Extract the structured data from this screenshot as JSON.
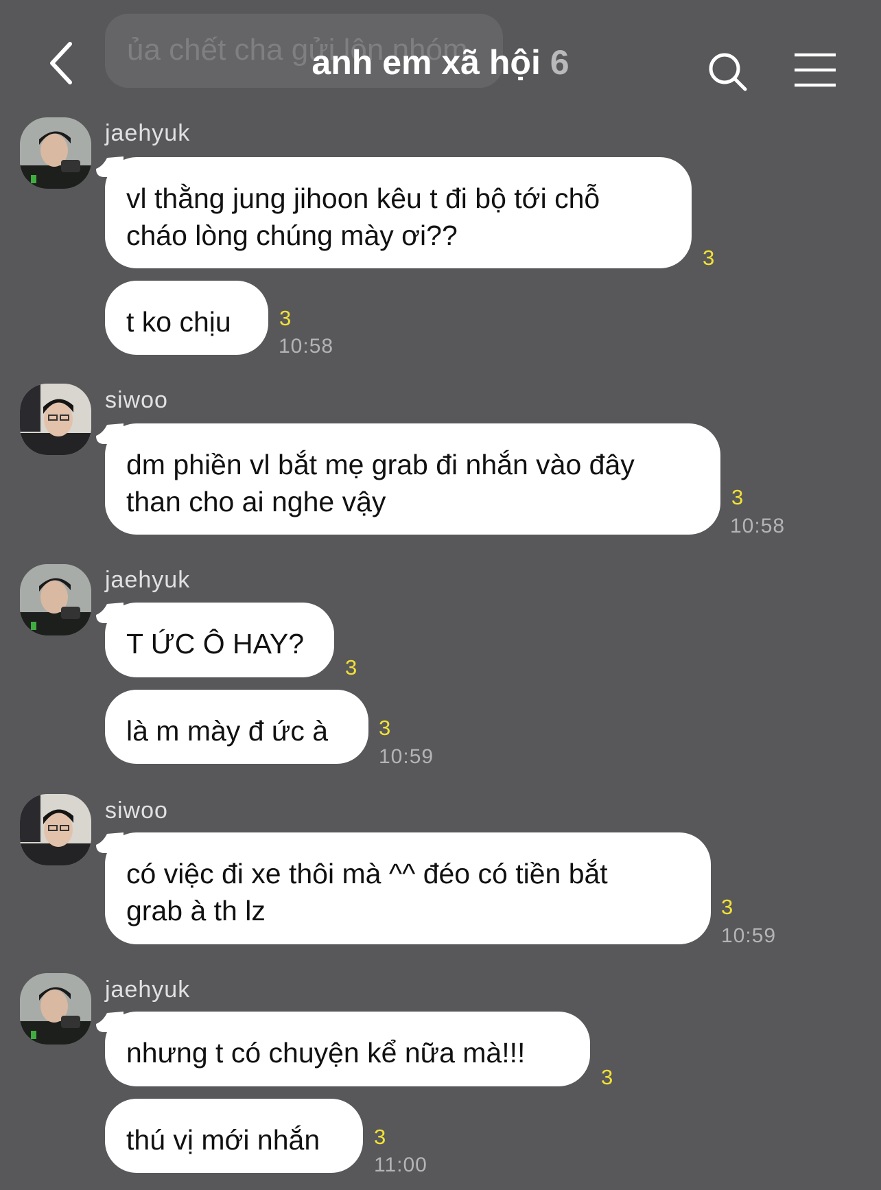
{
  "header": {
    "title": "anh em xã hội",
    "member_count": "6",
    "prev_message_preview": "ủa chết cha gửi lộn nhóm",
    "back_icon": "chevron-left-icon",
    "search_icon": "search-icon",
    "menu_icon": "hamburger-menu-icon"
  },
  "colors": {
    "background": "#58585b",
    "bubble": "#ffffff",
    "unread_count": "#f2e234",
    "timestamp": "#b4b4b7"
  },
  "groups": [
    {
      "sender": "jaehyuk",
      "messages": [
        {
          "text_line1": "vl thằng jung jihoon kêu t đi bộ tới chỗ",
          "text_line2": "cháo lòng chúng mày ơi??",
          "unread": "3",
          "time": ""
        },
        {
          "text_line1": "t ko chịu",
          "text_line2": "",
          "unread": "3",
          "time": "10:58"
        }
      ]
    },
    {
      "sender": "siwoo",
      "messages": [
        {
          "text_line1": "dm phiền vl bắt mẹ grab đi nhắn vào đây",
          "text_line2": "than cho ai nghe vậy",
          "unread": "3",
          "time": "10:58"
        }
      ]
    },
    {
      "sender": "jaehyuk",
      "messages": [
        {
          "text_line1": "T ỨC Ô HAY?",
          "text_line2": "",
          "unread": "3",
          "time": ""
        },
        {
          "text_line1": "là m mày đ ức à",
          "text_line2": "",
          "unread": "3",
          "time": "10:59"
        }
      ]
    },
    {
      "sender": "siwoo",
      "messages": [
        {
          "text_line1": "có việc đi xe thôi mà ^^ đéo có tiền bắt",
          "text_line2": "grab à th lz",
          "unread": "3",
          "time": "10:59"
        }
      ]
    },
    {
      "sender": "jaehyuk",
      "messages": [
        {
          "text_line1": "nhưng t có chuyện kể nữa mà!!!",
          "text_line2": "",
          "unread": "3",
          "time": ""
        },
        {
          "text_line1": "thú vị mới nhắn",
          "text_line2": "",
          "unread": "3",
          "time": "11:00"
        }
      ]
    }
  ]
}
